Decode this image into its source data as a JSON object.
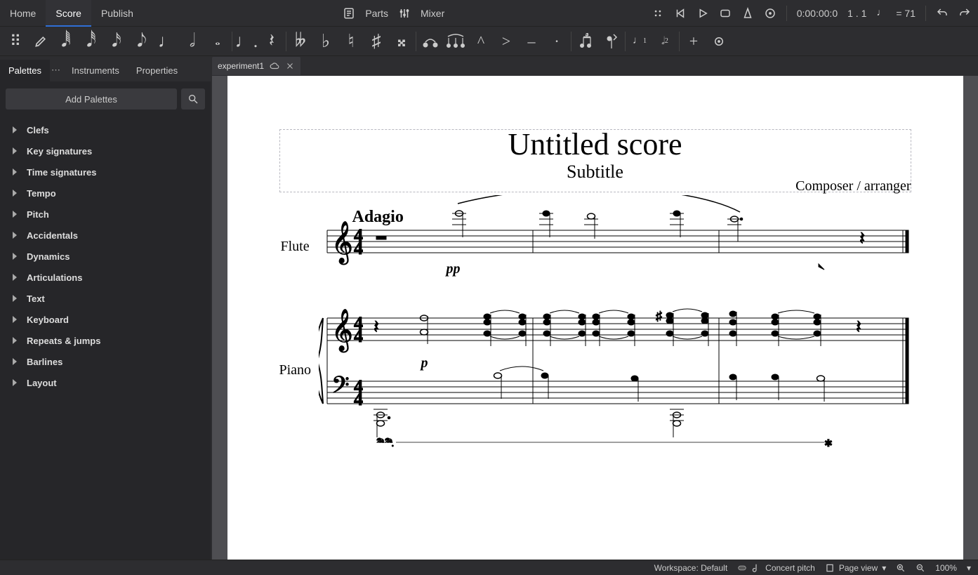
{
  "menu": {
    "home": "Home",
    "score": "Score",
    "publish": "Publish",
    "parts": "Parts",
    "mixer": "Mixer",
    "time": "0:00:00:0",
    "bars": "1 . 1",
    "tempo": "= 71"
  },
  "toolbarLabels": {
    "handle": "drag-handle",
    "pencil": "edit-pencil",
    "n64": "♬",
    "n32": "♫",
    "n16": "♪",
    "n8": "♪",
    "n4": "♩",
    "n2": "𝅗𝅥",
    "n1": "𝅝",
    "dot": "♩.",
    "rest": "𝄽",
    "dflat": "𝄫",
    "flat": "♭",
    "nat": "♮",
    "sharp": "♯",
    "dsharp": "𝄪",
    "tie": "⁀",
    "slur": "⁀",
    "marc": "^",
    "acc": ">",
    "ten": "–",
    "stac": "·",
    "tuplet": "♫³",
    "flip": "↕",
    "v1": "♩1",
    "v2": "𝅗𝅥 2",
    "plus": "+",
    "gear": "⚙"
  },
  "leftTabs": {
    "palettes": "Palettes",
    "instruments": "Instruments",
    "properties": "Properties"
  },
  "docTab": {
    "name": "experiment1"
  },
  "sidebar": {
    "add": "Add Palettes",
    "items": [
      {
        "label": "Clefs",
        "bold": true
      },
      {
        "label": "Key signatures",
        "bold": true
      },
      {
        "label": "Time signatures",
        "bold": true
      },
      {
        "label": "Tempo",
        "bold": true
      },
      {
        "label": "Pitch",
        "bold": true
      },
      {
        "label": "Accidentals",
        "bold": true
      },
      {
        "label": "Dynamics",
        "bold": true
      },
      {
        "label": "Articulations",
        "bold": true
      },
      {
        "label": "Text",
        "bold": true
      },
      {
        "label": "Keyboard",
        "bold": true
      },
      {
        "label": "Repeats & jumps",
        "bold": true
      },
      {
        "label": "Barlines",
        "bold": true
      },
      {
        "label": "Layout",
        "bold": true
      }
    ]
  },
  "score": {
    "title": "Untitled score",
    "subtitle": "Subtitle",
    "composer": "Composer / arranger",
    "tempo": "Adagio",
    "instruments": {
      "flute": "Flute",
      "piano": "Piano"
    },
    "dynamics": {
      "flute": "pp",
      "piano": "p"
    },
    "pedal": "𝆮"
  },
  "status": {
    "workspace": "Workspace: Default",
    "concert": "Concert pitch",
    "view": "Page view",
    "zoom": "100%"
  }
}
